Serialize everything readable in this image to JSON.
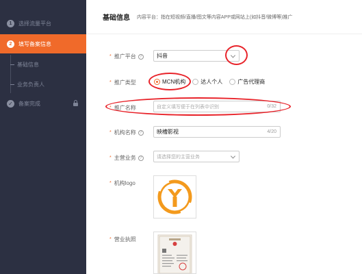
{
  "sidebar": {
    "steps": [
      {
        "num": "1",
        "label": "选择流量平台"
      },
      {
        "num": "2",
        "label": "填写备案信息"
      }
    ],
    "subitems": [
      "基础信息",
      "业务负责人"
    ],
    "final_step": {
      "label": "备案完成"
    }
  },
  "header": {
    "title": "基础信息",
    "subtitle": "内容平台：指在短视频/直播/图文等内容APP或网站上(如抖音/微博等)推广"
  },
  "form": {
    "platform": {
      "label": "推广平台",
      "value": "抖音"
    },
    "type": {
      "label": "推广类型",
      "options": [
        {
          "label": "MCN机构",
          "checked": true
        },
        {
          "label": "达人个人",
          "checked": false
        },
        {
          "label": "广告代理商",
          "checked": false
        }
      ]
    },
    "promo_name": {
      "label": "推广名称",
      "placeholder": "自定义填写便于在列表中识别",
      "counter": "0/32"
    },
    "org_name": {
      "label": "机构名称",
      "value": "映槽影视",
      "counter": "4/20"
    },
    "main_business": {
      "label": "主营业务",
      "placeholder": "请选择您的主营业务"
    },
    "logo": {
      "label": "机构logo"
    },
    "license": {
      "label": "营业执照"
    }
  },
  "colors": {
    "accent": "#f06a2a",
    "sidebar_bg": "#2c3042",
    "annotation": "#e8232a"
  }
}
